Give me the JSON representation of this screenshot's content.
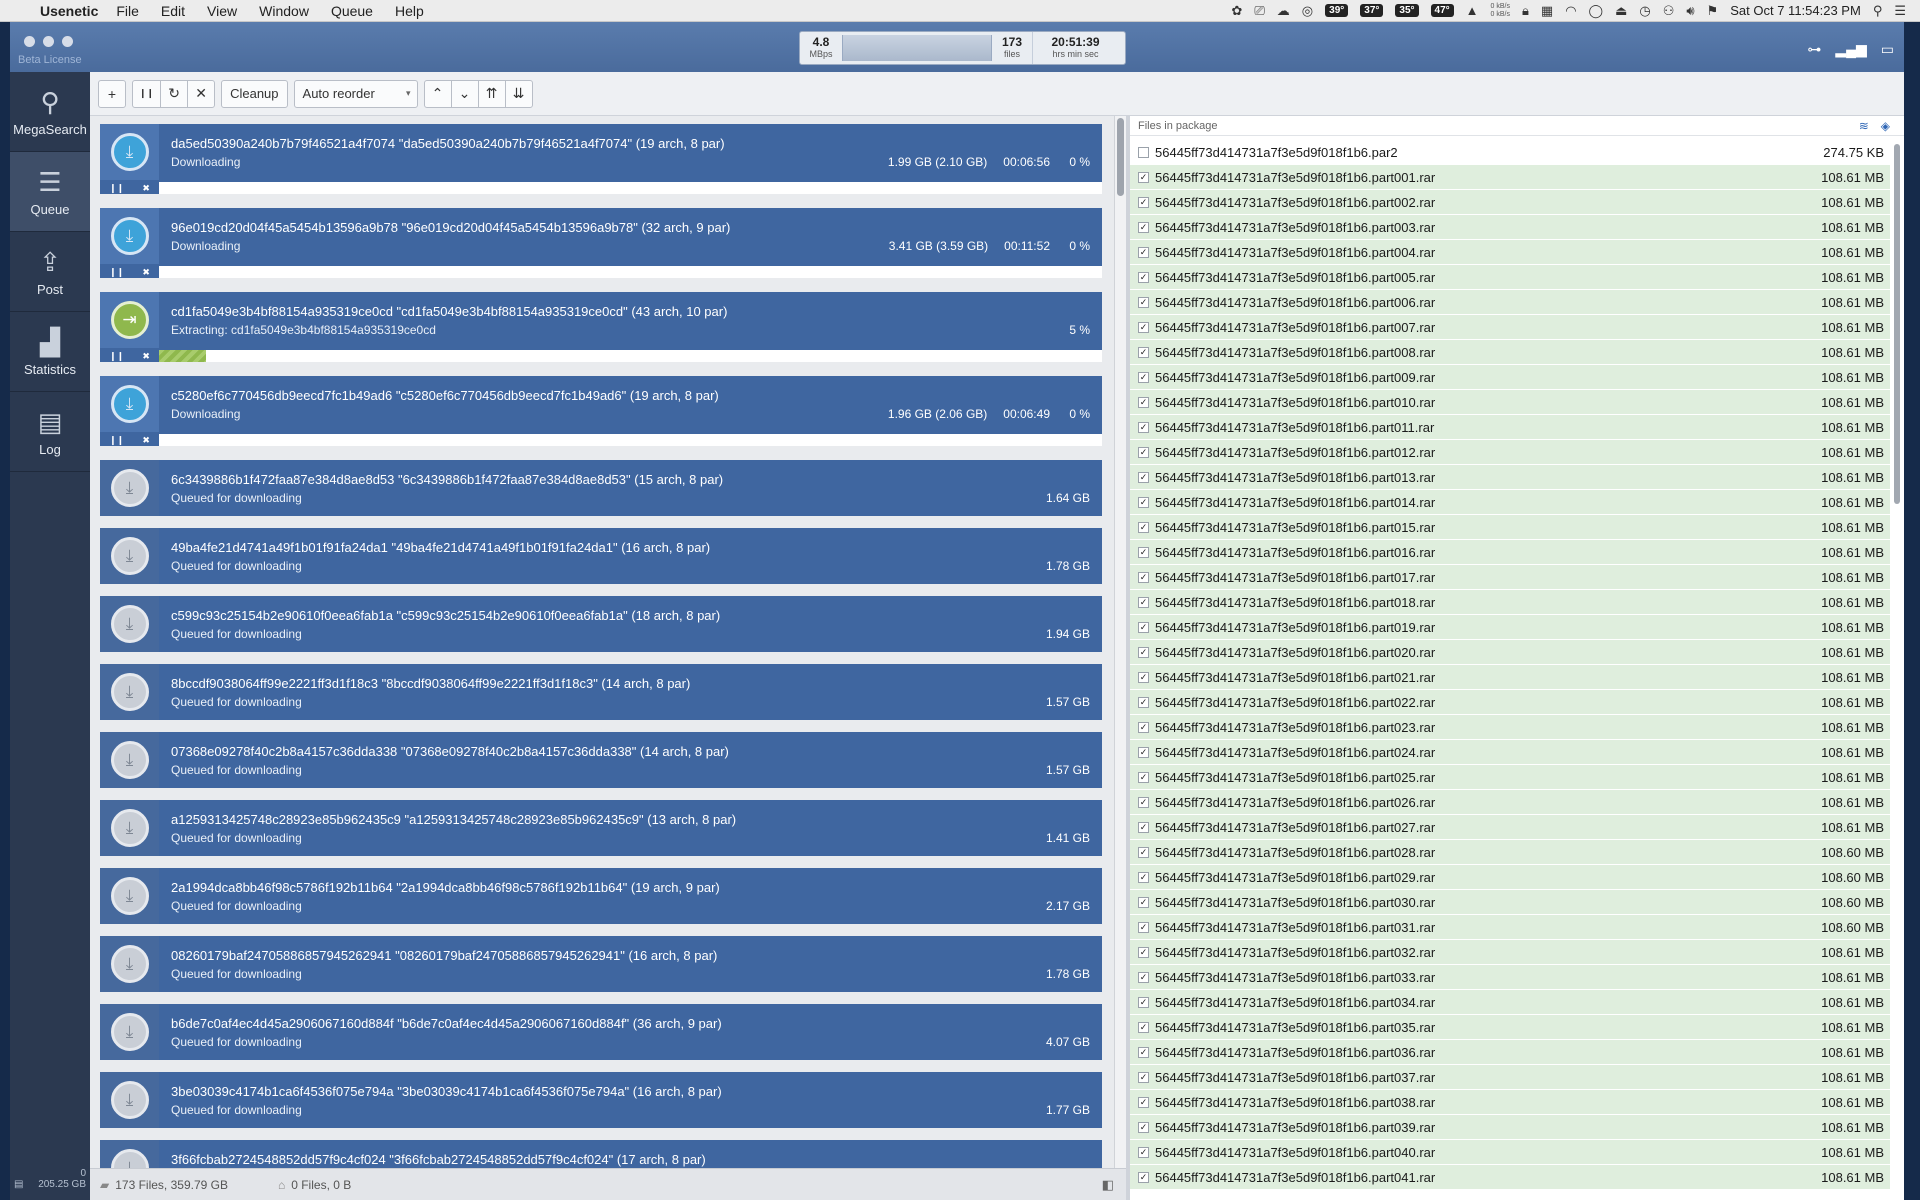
{
  "menubar": {
    "app_name": "Usenetic",
    "menus": [
      "File",
      "Edit",
      "View",
      "Window",
      "Queue",
      "Help"
    ],
    "temps": [
      "39°",
      "37°",
      "35°",
      "47°"
    ],
    "net_up": "0 kB/s",
    "net_down": "0 kB/s",
    "clock": "Sat Oct 7  11:54:23 PM"
  },
  "window": {
    "beta_label": "Beta License",
    "speed": {
      "value": "4.8",
      "unit": "MBps"
    },
    "files": {
      "value": "173",
      "unit": "files"
    },
    "time": {
      "value": "20:51:39",
      "unit": "hrs  min  sec"
    }
  },
  "sidebar": {
    "items": [
      {
        "label": "MegaSearch",
        "icon": "magnifier-icon"
      },
      {
        "label": "Queue",
        "icon": "queue-stack-icon"
      },
      {
        "label": "Post",
        "icon": "upload-tray-icon"
      },
      {
        "label": "Statistics",
        "icon": "bar-chart-icon"
      },
      {
        "label": "Log",
        "icon": "document-icon"
      }
    ],
    "storage_count": "0",
    "storage_size": "205.25 GB"
  },
  "toolbar": {
    "add": "+",
    "pause": "❙❙",
    "retry": "↻",
    "remove": "✕",
    "cleanup": "Cleanup",
    "reorder_value": "Auto reorder",
    "move_up": "⌃",
    "move_down": "⌄",
    "move_top": "⇈",
    "move_bottom": "⇊"
  },
  "queue": [
    {
      "title": "da5ed50390a240b7b79f46521a4f7074 \"da5ed50390a240b7b79f46521a4f7074\" (19 arch, 8 par)",
      "status": "Downloading",
      "size": "1.99 GB (2.10 GB)",
      "eta": "00:06:56",
      "percent": "0 %",
      "progress": 0,
      "state": "downloading"
    },
    {
      "title": "96e019cd20d04f45a5454b13596a9b78 \"96e019cd20d04f45a5454b13596a9b78\" (32 arch, 9 par)",
      "status": "Downloading",
      "size": "3.41 GB (3.59 GB)",
      "eta": "00:11:52",
      "percent": "0 %",
      "progress": 0,
      "state": "downloading"
    },
    {
      "title": "cd1fa5049e3b4bf88154a935319ce0cd \"cd1fa5049e3b4bf88154a935319ce0cd\" (43 arch, 10 par)",
      "status": "Extracting: cd1fa5049e3b4bf88154a935319ce0cd",
      "size": "",
      "eta": "",
      "percent": "5 %",
      "progress": 0.05,
      "state": "extracting"
    },
    {
      "title": "c5280ef6c770456db9eecd7fc1b49ad6 \"c5280ef6c770456db9eecd7fc1b49ad6\" (19 arch, 8 par)",
      "status": "Downloading",
      "size": "1.96 GB (2.06 GB)",
      "eta": "00:06:49",
      "percent": "0 %",
      "progress": 0,
      "state": "downloading"
    },
    {
      "title": "6c3439886b1f472faa87e384d8ae8d53 \"6c3439886b1f472faa87e384d8ae8d53\" (15 arch, 8 par)",
      "status": "Queued for downloading",
      "size": "1.64 GB",
      "state": "queued"
    },
    {
      "title": "49ba4fe21d4741a49f1b01f91fa24da1 \"49ba4fe21d4741a49f1b01f91fa24da1\" (16 arch, 8 par)",
      "status": "Queued for downloading",
      "size": "1.78 GB",
      "state": "queued"
    },
    {
      "title": "c599c93c25154b2e90610f0eea6fab1a \"c599c93c25154b2e90610f0eea6fab1a\" (18 arch, 8 par)",
      "status": "Queued for downloading",
      "size": "1.94 GB",
      "state": "queued"
    },
    {
      "title": "8bccdf9038064ff99e2221ff3d1f18c3 \"8bccdf9038064ff99e2221ff3d1f18c3\" (14 arch, 8 par)",
      "status": "Queued for downloading",
      "size": "1.57 GB",
      "state": "queued"
    },
    {
      "title": "07368e09278f40c2b8a4157c36dda338 \"07368e09278f40c2b8a4157c36dda338\" (14 arch, 8 par)",
      "status": "Queued for downloading",
      "size": "1.57 GB",
      "state": "queued"
    },
    {
      "title": "a1259313425748c28923e85b962435c9 \"a1259313425748c28923e85b962435c9\" (13 arch, 8 par)",
      "status": "Queued for downloading",
      "size": "1.41 GB",
      "state": "queued"
    },
    {
      "title": "2a1994dca8bb46f98c5786f192b11b64 \"2a1994dca8bb46f98c5786f192b11b64\" (19 arch, 9 par)",
      "status": "Queued for downloading",
      "size": "2.17 GB",
      "state": "queued"
    },
    {
      "title": "08260179baf24705886857945262941 \"08260179baf24705886857945262941\" (16 arch, 8 par)",
      "status": "Queued for downloading",
      "size": "1.78 GB",
      "state": "queued"
    },
    {
      "title": "b6de7c0af4ec4d45a2906067160d884f \"b6de7c0af4ec4d45a2906067160d884f\" (36 arch, 9 par)",
      "status": "Queued for downloading",
      "size": "4.07 GB",
      "state": "queued"
    },
    {
      "title": "3be03039c4174b1ca6f4536f075e794a \"3be03039c4174b1ca6f4536f075e794a\" (16 arch, 8 par)",
      "status": "Queued for downloading",
      "size": "1.77 GB",
      "state": "queued"
    },
    {
      "title": "3f66fcbab2724548852dd57f9c4cf024 \"3f66fcbab2724548852dd57f9c4cf024\" (17 arch, 8 par)",
      "status": "Queued for downloading",
      "size": "",
      "state": "queued"
    }
  ],
  "statusbar": {
    "files_total": "173 Files, 359.79 GB",
    "files_selected": "0 Files, 0 B"
  },
  "files_panel": {
    "header": "Files in package",
    "files": [
      {
        "name": "56445ff73d414731a7f3e5d9f018f1b6.par2",
        "size": "274.75 KB",
        "checked": false
      },
      {
        "name": "56445ff73d414731a7f3e5d9f018f1b6.part001.rar",
        "size": "108.61 MB",
        "checked": true
      },
      {
        "name": "56445ff73d414731a7f3e5d9f018f1b6.part002.rar",
        "size": "108.61 MB",
        "checked": true
      },
      {
        "name": "56445ff73d414731a7f3e5d9f018f1b6.part003.rar",
        "size": "108.61 MB",
        "checked": true
      },
      {
        "name": "56445ff73d414731a7f3e5d9f018f1b6.part004.rar",
        "size": "108.61 MB",
        "checked": true
      },
      {
        "name": "56445ff73d414731a7f3e5d9f018f1b6.part005.rar",
        "size": "108.61 MB",
        "checked": true
      },
      {
        "name": "56445ff73d414731a7f3e5d9f018f1b6.part006.rar",
        "size": "108.61 MB",
        "checked": true
      },
      {
        "name": "56445ff73d414731a7f3e5d9f018f1b6.part007.rar",
        "size": "108.61 MB",
        "checked": true
      },
      {
        "name": "56445ff73d414731a7f3e5d9f018f1b6.part008.rar",
        "size": "108.61 MB",
        "checked": true
      },
      {
        "name": "56445ff73d414731a7f3e5d9f018f1b6.part009.rar",
        "size": "108.61 MB",
        "checked": true
      },
      {
        "name": "56445ff73d414731a7f3e5d9f018f1b6.part010.rar",
        "size": "108.61 MB",
        "checked": true
      },
      {
        "name": "56445ff73d414731a7f3e5d9f018f1b6.part011.rar",
        "size": "108.61 MB",
        "checked": true
      },
      {
        "name": "56445ff73d414731a7f3e5d9f018f1b6.part012.rar",
        "size": "108.61 MB",
        "checked": true
      },
      {
        "name": "56445ff73d414731a7f3e5d9f018f1b6.part013.rar",
        "size": "108.61 MB",
        "checked": true
      },
      {
        "name": "56445ff73d414731a7f3e5d9f018f1b6.part014.rar",
        "size": "108.61 MB",
        "checked": true
      },
      {
        "name": "56445ff73d414731a7f3e5d9f018f1b6.part015.rar",
        "size": "108.61 MB",
        "checked": true
      },
      {
        "name": "56445ff73d414731a7f3e5d9f018f1b6.part016.rar",
        "size": "108.61 MB",
        "checked": true
      },
      {
        "name": "56445ff73d414731a7f3e5d9f018f1b6.part017.rar",
        "size": "108.61 MB",
        "checked": true
      },
      {
        "name": "56445ff73d414731a7f3e5d9f018f1b6.part018.rar",
        "size": "108.61 MB",
        "checked": true
      },
      {
        "name": "56445ff73d414731a7f3e5d9f018f1b6.part019.rar",
        "size": "108.61 MB",
        "checked": true
      },
      {
        "name": "56445ff73d414731a7f3e5d9f018f1b6.part020.rar",
        "size": "108.61 MB",
        "checked": true
      },
      {
        "name": "56445ff73d414731a7f3e5d9f018f1b6.part021.rar",
        "size": "108.61 MB",
        "checked": true
      },
      {
        "name": "56445ff73d414731a7f3e5d9f018f1b6.part022.rar",
        "size": "108.61 MB",
        "checked": true
      },
      {
        "name": "56445ff73d414731a7f3e5d9f018f1b6.part023.rar",
        "size": "108.61 MB",
        "checked": true
      },
      {
        "name": "56445ff73d414731a7f3e5d9f018f1b6.part024.rar",
        "size": "108.61 MB",
        "checked": true
      },
      {
        "name": "56445ff73d414731a7f3e5d9f018f1b6.part025.rar",
        "size": "108.61 MB",
        "checked": true
      },
      {
        "name": "56445ff73d414731a7f3e5d9f018f1b6.part026.rar",
        "size": "108.61 MB",
        "checked": true
      },
      {
        "name": "56445ff73d414731a7f3e5d9f018f1b6.part027.rar",
        "size": "108.61 MB",
        "checked": true
      },
      {
        "name": "56445ff73d414731a7f3e5d9f018f1b6.part028.rar",
        "size": "108.60 MB",
        "checked": true
      },
      {
        "name": "56445ff73d414731a7f3e5d9f018f1b6.part029.rar",
        "size": "108.60 MB",
        "checked": true
      },
      {
        "name": "56445ff73d414731a7f3e5d9f018f1b6.part030.rar",
        "size": "108.60 MB",
        "checked": true
      },
      {
        "name": "56445ff73d414731a7f3e5d9f018f1b6.part031.rar",
        "size": "108.60 MB",
        "checked": true
      },
      {
        "name": "56445ff73d414731a7f3e5d9f018f1b6.part032.rar",
        "size": "108.61 MB",
        "checked": true
      },
      {
        "name": "56445ff73d414731a7f3e5d9f018f1b6.part033.rar",
        "size": "108.61 MB",
        "checked": true
      },
      {
        "name": "56445ff73d414731a7f3e5d9f018f1b6.part034.rar",
        "size": "108.61 MB",
        "checked": true
      },
      {
        "name": "56445ff73d414731a7f3e5d9f018f1b6.part035.rar",
        "size": "108.61 MB",
        "checked": true
      },
      {
        "name": "56445ff73d414731a7f3e5d9f018f1b6.part036.rar",
        "size": "108.61 MB",
        "checked": true
      },
      {
        "name": "56445ff73d414731a7f3e5d9f018f1b6.part037.rar",
        "size": "108.61 MB",
        "checked": true
      },
      {
        "name": "56445ff73d414731a7f3e5d9f018f1b6.part038.rar",
        "size": "108.61 MB",
        "checked": true
      },
      {
        "name": "56445ff73d414731a7f3e5d9f018f1b6.part039.rar",
        "size": "108.61 MB",
        "checked": true
      },
      {
        "name": "56445ff73d414731a7f3e5d9f018f1b6.part040.rar",
        "size": "108.61 MB",
        "checked": true
      },
      {
        "name": "56445ff73d414731a7f3e5d9f018f1b6.part041.rar",
        "size": "108.61 MB",
        "checked": true
      }
    ]
  },
  "colors": {
    "accent": "#3f66a0",
    "progress": "#8fb84d",
    "checked_row": "#dfeedd"
  }
}
